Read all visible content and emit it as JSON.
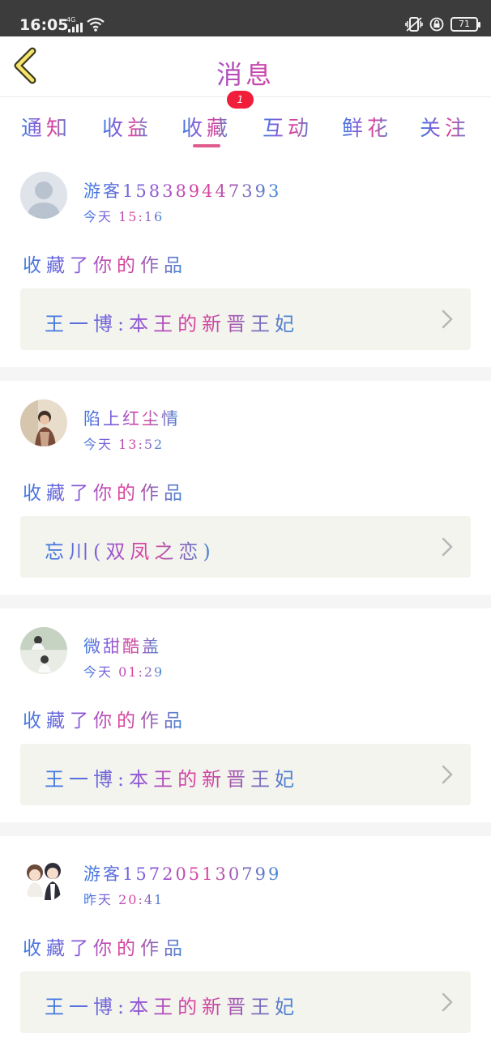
{
  "status_bar": {
    "time": "16:05",
    "network": "4G",
    "battery": "71"
  },
  "header": {
    "title": "消息"
  },
  "tabs": [
    {
      "label": "通知"
    },
    {
      "label": "收益"
    },
    {
      "label": "收藏"
    },
    {
      "label": "互动"
    },
    {
      "label": "鲜花"
    },
    {
      "label": "关注"
    }
  ],
  "active_tab": "收藏",
  "badge": {
    "count": "1"
  },
  "messages": [
    {
      "user": "游客158389447393",
      "time": "今天 15:16",
      "action": "收藏了你的作品",
      "work": "王一博:本王的新晋王妃",
      "avatar": "default-avatar"
    },
    {
      "user": "陷上红尘情",
      "time": "今天 13:52",
      "action": "收藏了你的作品",
      "work": "忘川(双凤之恋)",
      "avatar": "photo-avatar"
    },
    {
      "user": "微甜酷盖",
      "time": "今天 01:29",
      "action": "收藏了你的作品",
      "work": "王一博:本王的新晋王妃",
      "avatar": "photo-avatar"
    },
    {
      "user": "游客157205130799",
      "time": "昨天 20:41",
      "action": "收藏了你的作品",
      "work": "王一博:本王的新晋王妃",
      "avatar": "anime-avatar"
    }
  ],
  "colors": {
    "accent_underline": "#e05b8e",
    "badge": "#f01d3b",
    "work_bg": "#f4f4ee",
    "status_bar": "#3c3c3c"
  }
}
